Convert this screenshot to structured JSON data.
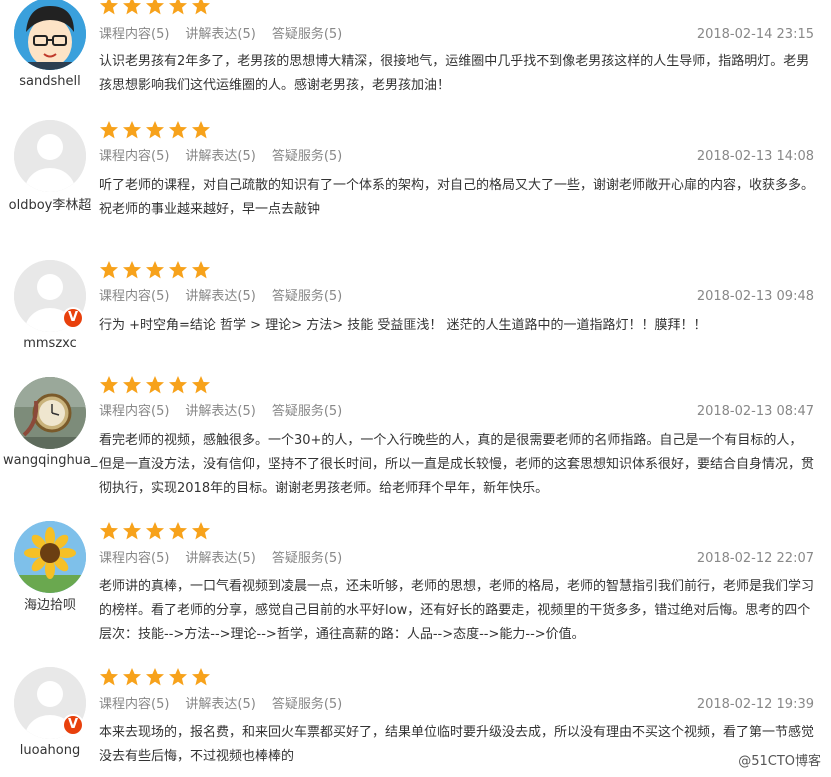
{
  "reviews": [
    {
      "username": "sandshell",
      "avatar": "cartoon-boy-avatar",
      "rating": 5,
      "tags": [
        "课程内容(5)",
        "讲解表达(5)",
        "答疑服务(5)"
      ],
      "date": "2018-02-14 23:15",
      "content": "认识老男孩有2年多了，老男孩的思想博大精深，很接地气，运维圈中几乎找不到像老男孩这样的人生导师，指路明灯。老男孩思想影响我们这代运维圈的人。感谢老男孩，老男孩加油！"
    },
    {
      "username": "oldboy李林超",
      "avatar": "default-avatar",
      "rating": 5,
      "tags": [
        "课程内容(5)",
        "讲解表达(5)",
        "答疑服务(5)"
      ],
      "date": "2018-02-13 14:08",
      "content": "听了老师的课程，对自己疏散的知识有了一个体系的架构，对自己的格局又大了一些，谢谢老师敞开心扉的内容，收获多多。祝老师的事业越来越好，早一点去敲钟"
    },
    {
      "username": "mmszxc",
      "avatar": "default-avatar",
      "badge": "V",
      "rating": 5,
      "tags": [
        "课程内容(5)",
        "讲解表达(5)",
        "答疑服务(5)"
      ],
      "date": "2018-02-13 09:48",
      "content": "行为 +时空角=结论 哲学 > 理论> 方法> 技能 受益匪浅！ 迷茫的人生道路中的一道指路灯！！膜拜！！"
    },
    {
      "username": "wangqinghua_",
      "avatar": "pocket-watch-avatar",
      "rating": 5,
      "tags": [
        "课程内容(5)",
        "讲解表达(5)",
        "答疑服务(5)"
      ],
      "date": "2018-02-13 08:47",
      "content": "看完老师的视频，感触很多。一个30+的人，一个入行晚些的人，真的是很需要老师的名师指路。自己是一个有目标的人，但是一直没方法，没有信仰，坚持不了很长时间，所以一直是成长较慢，老师的这套思想知识体系很好，要结合自身情况，贯彻执行，实现2018年的目标。谢谢老男孩老师。给老师拜个早年，新年快乐。"
    },
    {
      "username": "海边拾呗",
      "avatar": "sunflower-avatar",
      "rating": 5,
      "tags": [
        "课程内容(5)",
        "讲解表达(5)",
        "答疑服务(5)"
      ],
      "date": "2018-02-12 22:07",
      "content": "老师讲的真棒，一口气看视频到凌晨一点，还未听够，老师的思想，老师的格局，老师的智慧指引我们前行，老师是我们学习的榜样。看了老师的分享，感觉自己目前的水平好low，还有好长的路要走，视频里的干货多多，错过绝对后悔。思考的四个层次：技能-->方法-->理论-->哲学，通往高薪的路：人品-->态度-->能力-->价值。"
    },
    {
      "username": "luoahong",
      "avatar": "default-avatar",
      "badge": "V",
      "rating": 5,
      "tags": [
        "课程内容(5)",
        "讲解表达(5)",
        "答疑服务(5)"
      ],
      "date": "2018-02-12 19:39",
      "content": "本来去现场的，报名费，和来回火车票都买好了，结果单位临时要升级没去成，所以没有理由不买这个视频，看了第一节感觉没去有些后悔，不过视频也棒棒的"
    }
  ],
  "watermark": "@51CTO博客",
  "colors": {
    "star": "#f7a21b",
    "badge": "#e8400c",
    "meta": "#888888"
  }
}
